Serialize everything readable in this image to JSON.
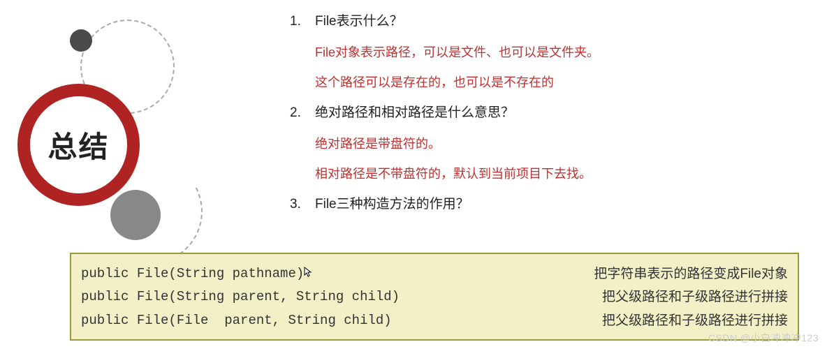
{
  "badge": {
    "label": "总结"
  },
  "items": [
    {
      "num": "1.",
      "question": "File表示什么？",
      "answers": [
        "File对象表示路径，可以是文件、也可以是文件夹。",
        "这个路径可以是存在的，也可以是不存在的"
      ]
    },
    {
      "num": "2.",
      "question": "绝对路径和相对路径是什么意思？",
      "answers": [
        "绝对路径是带盘符的。",
        "相对路径是不带盘符的，默认到当前项目下去找。"
      ]
    },
    {
      "num": "3.",
      "question": "File三种构造方法的作用？",
      "answers": []
    }
  ],
  "code_rows": [
    {
      "sig": "public File(String pathname)",
      "desc": "把字符串表示的路径变成File对象"
    },
    {
      "sig": "public File(String parent, String child)",
      "desc": "把父级路径和子级路径进行拼接"
    },
    {
      "sig": "public File(File  parent, String child)",
      "desc": "把父级路径和子级路径进行拼接"
    }
  ],
  "watermark": "CSDN @小白冲冲冲123"
}
